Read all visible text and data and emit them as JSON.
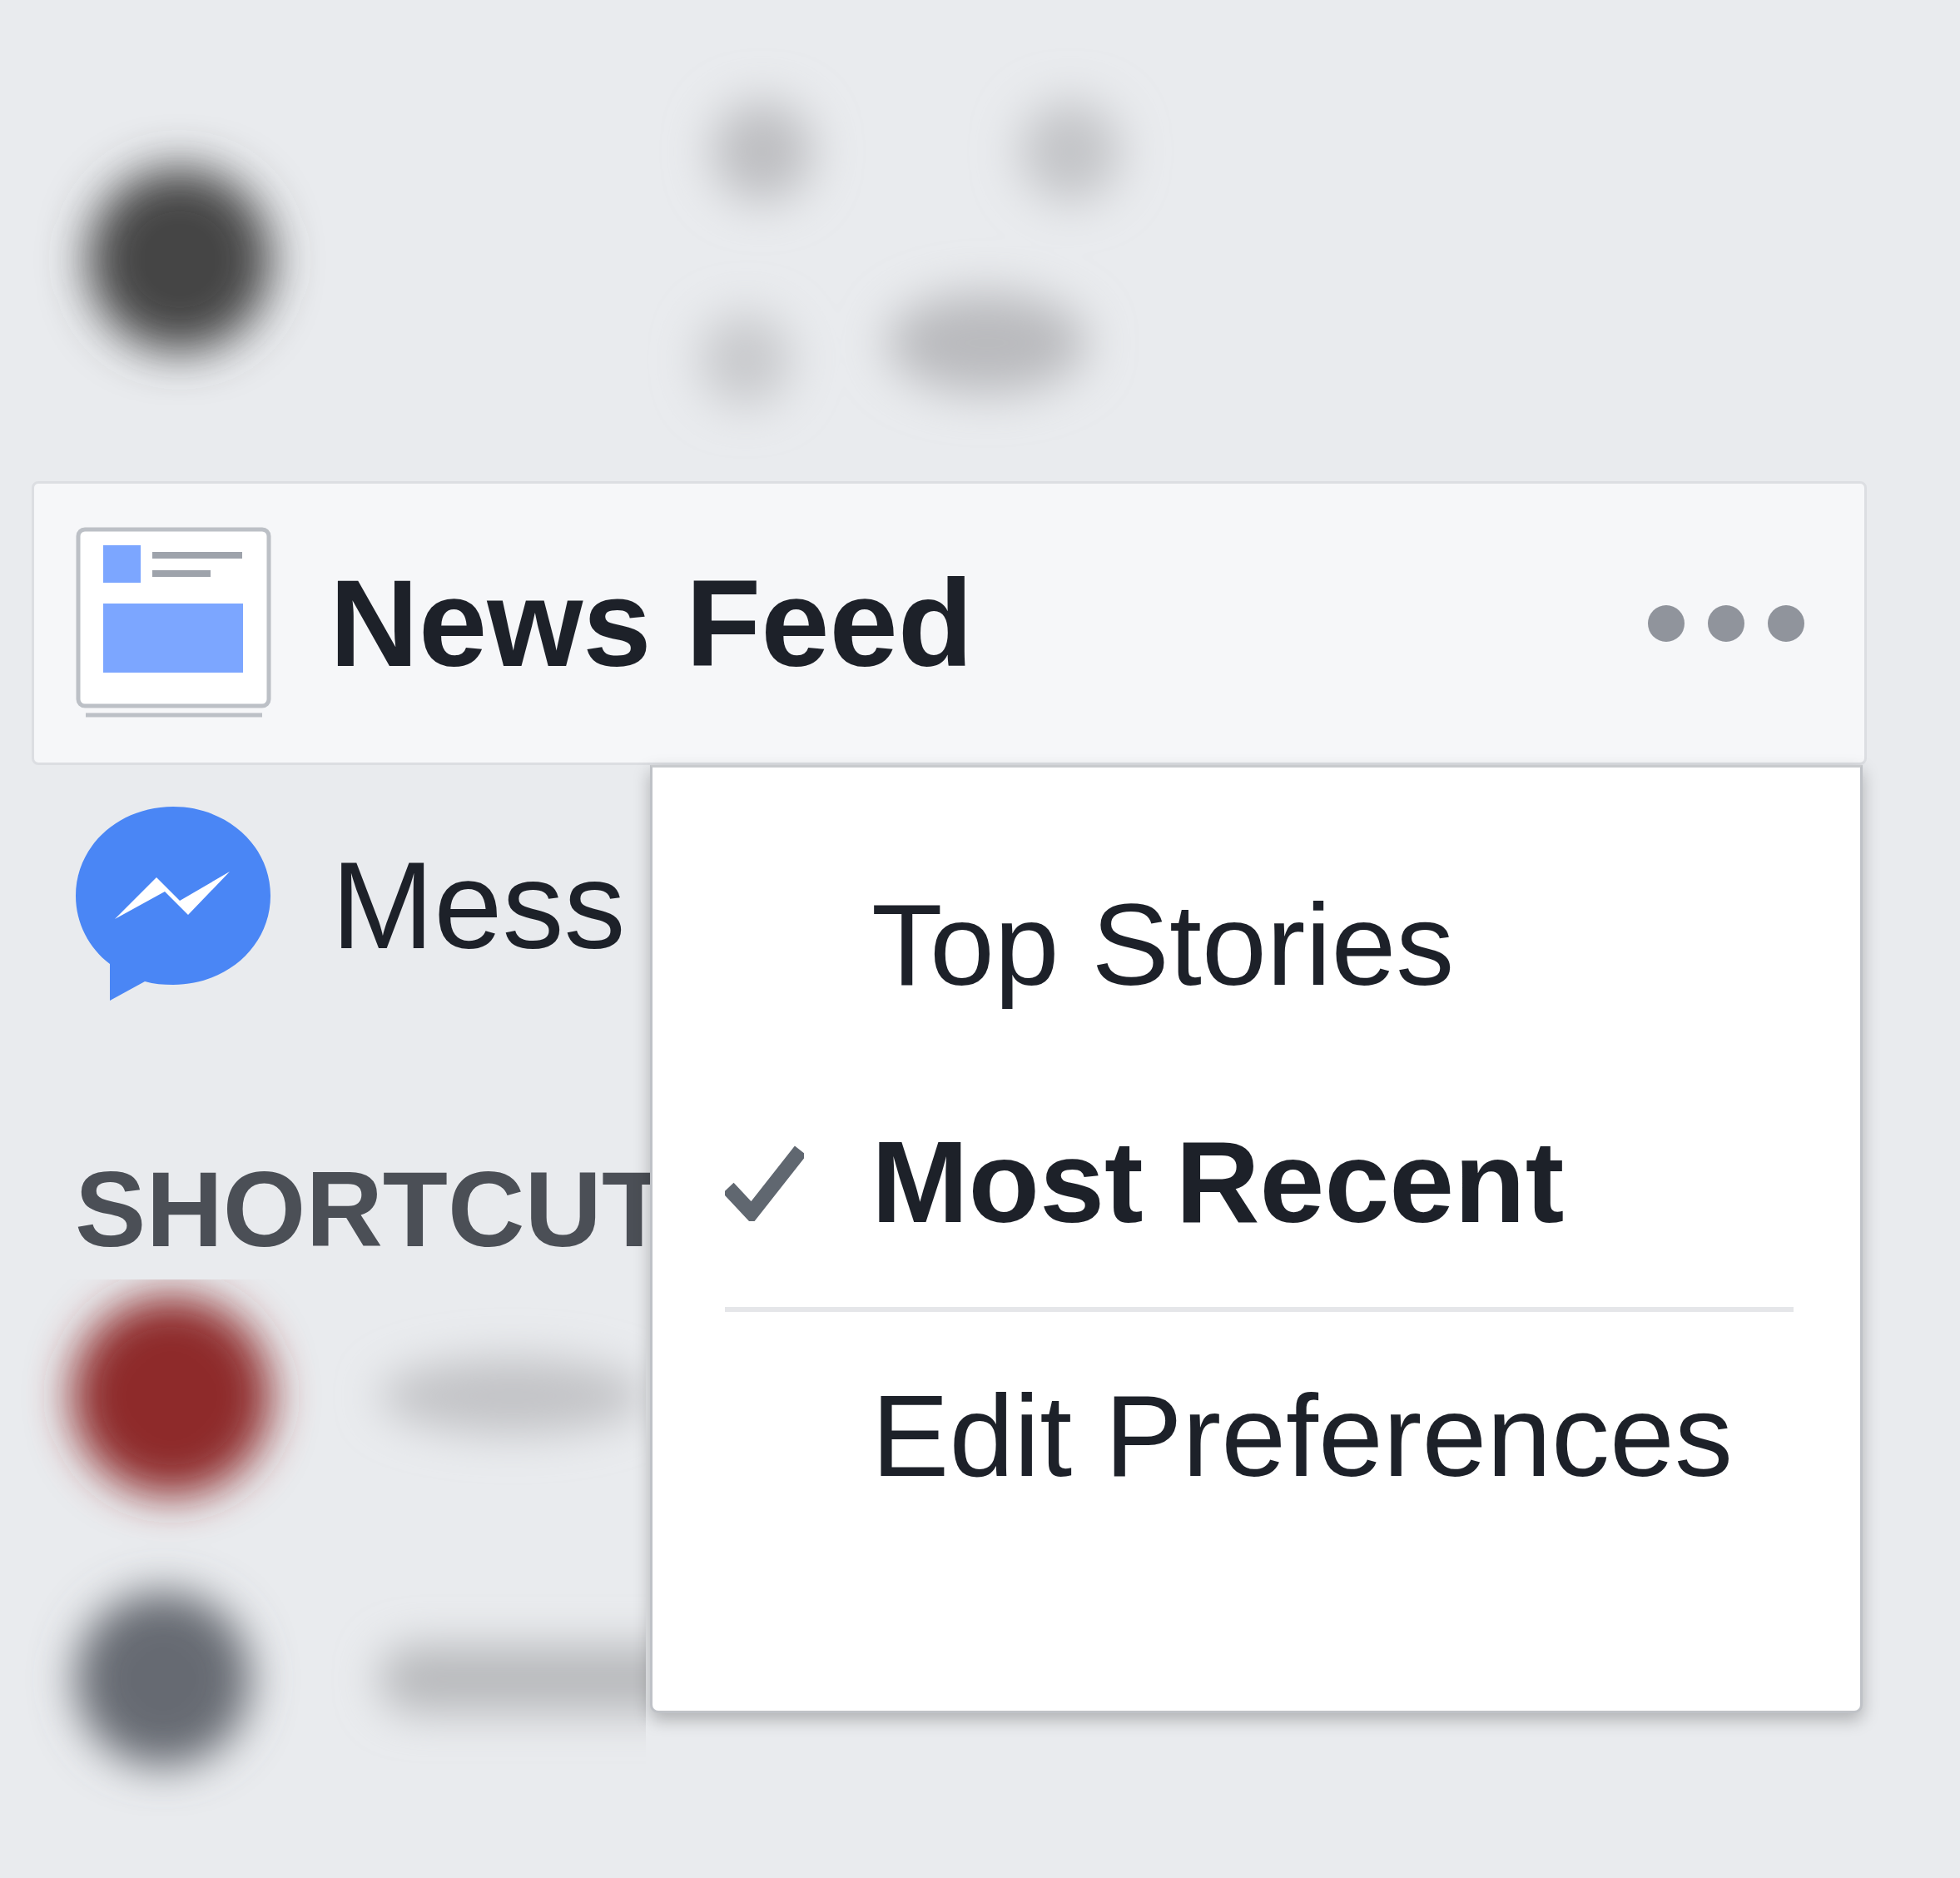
{
  "nav_items": [
    {
      "kind": "news",
      "label": "News Feed",
      "selected": true
    },
    {
      "kind": "messenger",
      "label": "Mess",
      "selected": false
    }
  ],
  "section_heading": "SHORTCUT",
  "dropdown": {
    "items": [
      {
        "kind": "option",
        "label": "Top Stories",
        "checked": false
      },
      {
        "kind": "option",
        "label": "Most Recent",
        "checked": true
      },
      {
        "kind": "divider"
      },
      {
        "kind": "option",
        "label": "Edit Preferences",
        "checked": false
      }
    ]
  }
}
